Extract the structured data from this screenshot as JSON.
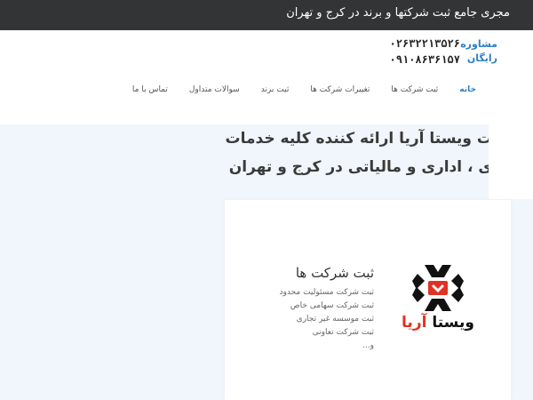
{
  "topbar": {
    "text": "مجری جامع ثبت شرکتها و برند در کرج و تهران"
  },
  "header": {
    "consult_line1": "مشاوره",
    "consult_line2": "رایگان",
    "phone1": "۰۲۶۳۲۲۱۳۵۲۶",
    "phone2": "۰۹۱۰۸۶۳۶۱۵۷"
  },
  "nav": {
    "items": [
      {
        "label": "خانه"
      },
      {
        "label": "ثبت شرکت ها"
      },
      {
        "label": "تغییرات شرکت ها"
      },
      {
        "label": "ثبت برند"
      },
      {
        "label": "سوالات متداول"
      },
      {
        "label": "تماس با ما"
      }
    ]
  },
  "hero": {
    "line1": "ت ویستا آریا ارائه کننده کلیه خدمات",
    "line2": "ی ، اداری و مالیاتی در کرج و تهران"
  },
  "card": {
    "title": "ثبت شرکت ها",
    "items": [
      "ثبت شرکت مسئولیت محدود",
      "ثبت شرکت سهامی خاص",
      "ثبت موسسه غیر تجاری",
      "ثبت شرکت تعاونی",
      "و..."
    ],
    "logo_text": "ویستا آریا"
  },
  "colors": {
    "topbar_bg": "#333436",
    "accent_blue": "#2d7fc1",
    "logo_red": "#e03224",
    "logo_black": "#111111",
    "hero_bg": "#f1f6fc"
  }
}
